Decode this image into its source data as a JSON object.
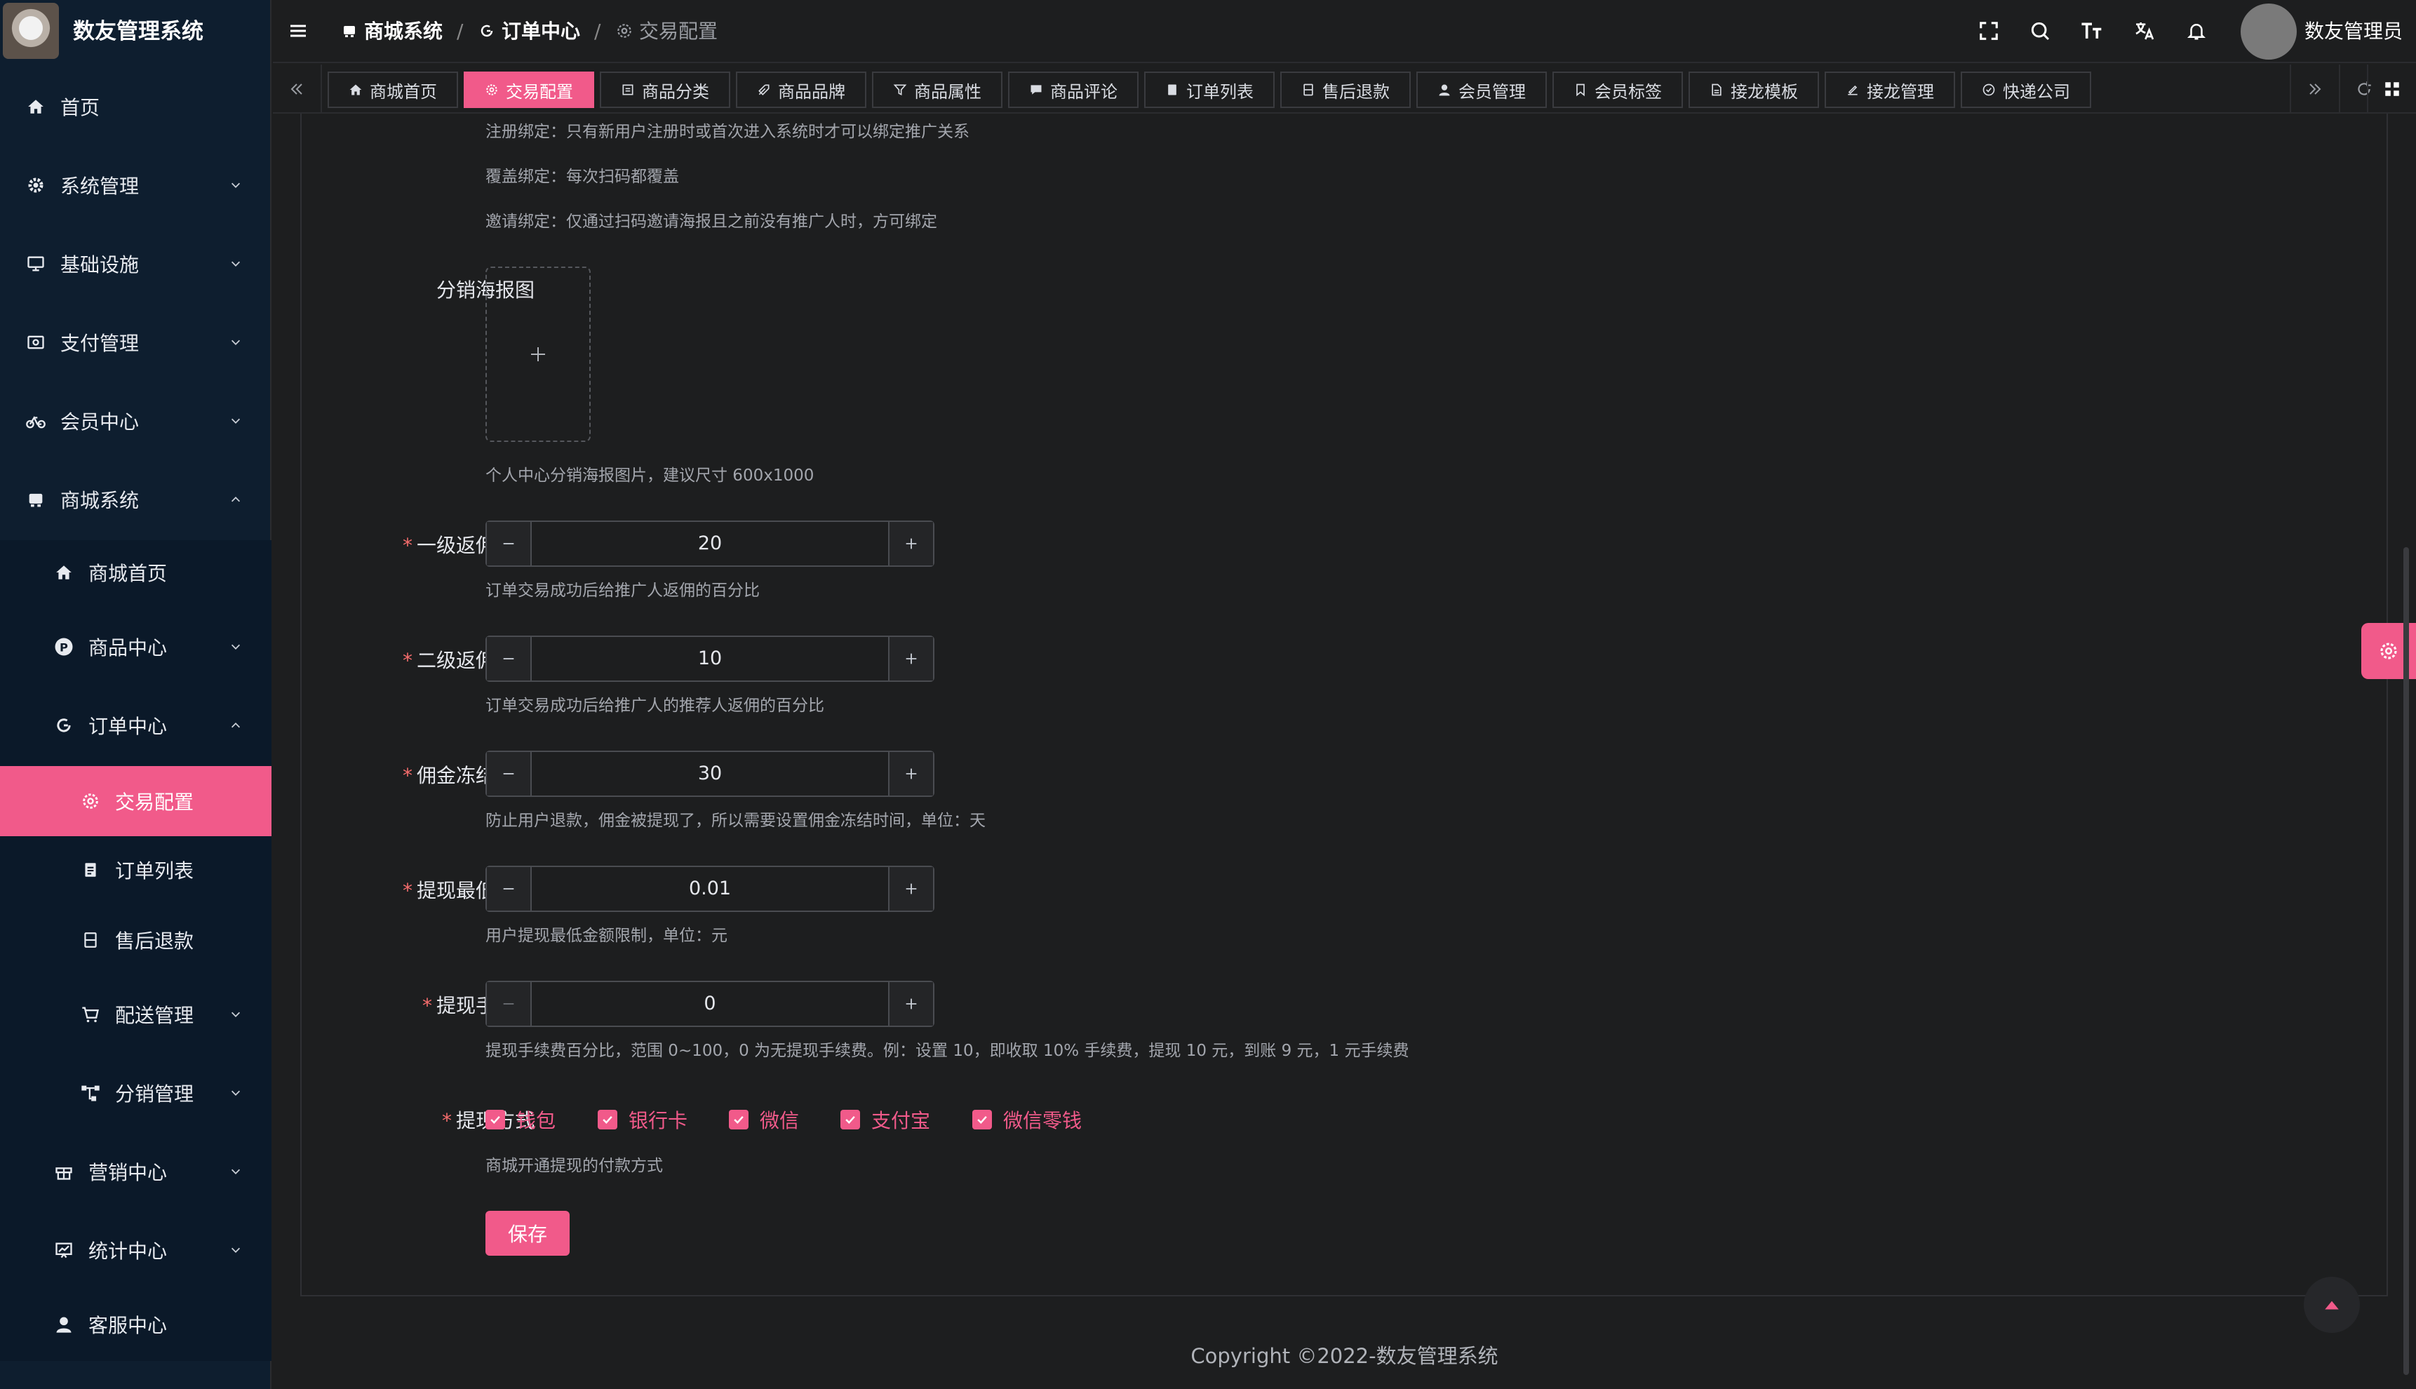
{
  "app": {
    "title": "数友管理系统"
  },
  "sidebar": {
    "items": [
      {
        "label": "首页",
        "icon": "home-icon"
      },
      {
        "label": "系统管理",
        "icon": "gear-icon"
      },
      {
        "label": "基础设施",
        "icon": "monitor-icon"
      },
      {
        "label": "支付管理",
        "icon": "payment-icon"
      },
      {
        "label": "会员中心",
        "icon": "bike-icon"
      },
      {
        "label": "商城系统",
        "icon": "shop-icon"
      }
    ],
    "mall_children": [
      {
        "label": "商城首页",
        "icon": "home-icon"
      },
      {
        "label": "商品中心",
        "icon": "product-icon"
      },
      {
        "label": "订单中心",
        "icon": "refresh-icon"
      }
    ],
    "order_children": [
      {
        "label": "交易配置",
        "icon": "gear-icon"
      },
      {
        "label": "订单列表",
        "icon": "clipboard-icon"
      },
      {
        "label": "售后退款",
        "icon": "document-icon"
      },
      {
        "label": "配送管理",
        "icon": "cart-icon"
      },
      {
        "label": "分销管理",
        "icon": "network-icon"
      }
    ],
    "more_items": [
      {
        "label": "营销中心",
        "icon": "gift-icon"
      },
      {
        "label": "统计中心",
        "icon": "chart-icon"
      },
      {
        "label": "客服中心",
        "icon": "user-icon"
      }
    ]
  },
  "breadcrumb": [
    "商城系统",
    "订单中心",
    "交易配置"
  ],
  "header": {
    "username": "数友管理员"
  },
  "tabs": [
    {
      "label": "商城首页",
      "icon": "home-icon",
      "active": false
    },
    {
      "label": "交易配置",
      "icon": "gear-icon",
      "active": true
    },
    {
      "label": "商品分类",
      "icon": "list-icon",
      "active": false
    },
    {
      "label": "商品品牌",
      "icon": "tag-icon",
      "active": false
    },
    {
      "label": "商品属性",
      "icon": "filter-icon",
      "active": false
    },
    {
      "label": "商品评论",
      "icon": "comment-icon",
      "active": false
    },
    {
      "label": "订单列表",
      "icon": "clipboard-icon",
      "active": false
    },
    {
      "label": "售后退款",
      "icon": "document-icon",
      "active": false
    },
    {
      "label": "会员管理",
      "icon": "user-icon",
      "active": false
    },
    {
      "label": "会员标签",
      "icon": "bookmark-icon",
      "active": false
    },
    {
      "label": "接龙模板",
      "icon": "file-icon",
      "active": false
    },
    {
      "label": "接龙管理",
      "icon": "edit-icon",
      "active": false
    },
    {
      "label": "快递公司",
      "icon": "check-circle-icon",
      "active": false
    }
  ],
  "form": {
    "binding_hints": [
      "注册绑定：只有新用户注册时或首次进入系统时才可以绑定推广关系",
      "覆盖绑定：每次扫码都覆盖",
      "邀请绑定：仅通过扫码邀请海报且之前没有推广人时，方可绑定"
    ],
    "poster": {
      "label": "分销海报图",
      "hint": "个人中心分销海报图片，建议尺寸 600x1000"
    },
    "level1": {
      "label": "一级返佣比例",
      "value": "20",
      "hint": "订单交易成功后给推广人返佣的百分比"
    },
    "level2": {
      "label": "二级返佣比例",
      "value": "10",
      "hint": "订单交易成功后给推广人的推荐人返佣的百分比"
    },
    "freeze_days": {
      "label": "佣金冻结天数",
      "value": "30",
      "hint": "防止用户退款，佣金被提现了，所以需要设置佣金冻结时间，单位：天"
    },
    "min_withdraw": {
      "label": "提现最低金额",
      "value": "0.01",
      "hint": "用户提现最低金额限制，单位：元"
    },
    "withdraw_fee": {
      "label": "提现手续费",
      "value": "0",
      "hint": "提现手续费百分比，范围 0~100，0 为无提现手续费。例：设置 10，即收取 10% 手续费，提现 10 元，到账 9 元，1 元手续费"
    },
    "withdraw_methods": {
      "label": "提现方式",
      "options": [
        "钱包",
        "银行卡",
        "微信",
        "支付宝",
        "微信零钱"
      ],
      "hint": "商城开通提现的付款方式"
    },
    "save_label": "保存"
  },
  "footer": {
    "copyright": "Copyright ©2022-数友管理系统"
  },
  "colors": {
    "accent": "#f15a8a",
    "sidebar_bg": "#0e1e2f",
    "page_bg": "#1d1e1f"
  }
}
